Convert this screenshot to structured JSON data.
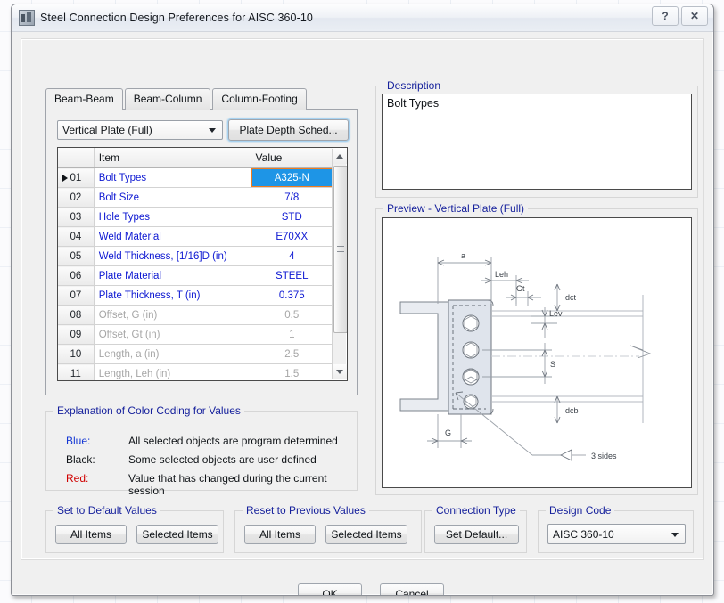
{
  "window": {
    "title": "Steel Connection Design Preferences for AISC 360-10",
    "icon": "app-building-icon",
    "help_btn": "?",
    "close_btn": "✕"
  },
  "tabs": [
    {
      "label": "Beam-Beam",
      "active": true
    },
    {
      "label": "Beam-Column",
      "active": false
    },
    {
      "label": "Column-Footing",
      "active": false
    }
  ],
  "toolbar": {
    "connection_type_value": "Vertical Plate (Full)",
    "plate_depth_label": "Plate Depth Sched..."
  },
  "grid": {
    "headers": {
      "rownum": "",
      "item": "Item",
      "value": "Value"
    },
    "selected_row": 1,
    "rows": [
      {
        "num": "01",
        "item": "Bolt Types",
        "value": "A325-N",
        "style": "blue",
        "selected": true
      },
      {
        "num": "02",
        "item": "Bolt Size",
        "value": "7/8",
        "style": "blue",
        "selected": false
      },
      {
        "num": "03",
        "item": "Hole Types",
        "value": "STD",
        "style": "blue",
        "selected": false
      },
      {
        "num": "04",
        "item": "Weld Material",
        "value": "E70XX",
        "style": "blue",
        "selected": false
      },
      {
        "num": "05",
        "item": "Weld Thickness, [1/16]D (in)",
        "value": "4",
        "style": "blue",
        "selected": false
      },
      {
        "num": "06",
        "item": "Plate Material",
        "value": "STEEL",
        "style": "blue",
        "selected": false
      },
      {
        "num": "07",
        "item": "Plate Thickness, T (in)",
        "value": "0.375",
        "style": "blue",
        "selected": false
      },
      {
        "num": "08",
        "item": "Offset, G (in)",
        "value": "0.5",
        "style": "grey",
        "selected": false
      },
      {
        "num": "09",
        "item": "Offset, Gt (in)",
        "value": "1",
        "style": "grey",
        "selected": false
      },
      {
        "num": "10",
        "item": "Length, a (in)",
        "value": "2.5",
        "style": "grey",
        "selected": false
      },
      {
        "num": "11",
        "item": "Length, Leh (in)",
        "value": "1.5",
        "style": "grey",
        "selected": false
      }
    ]
  },
  "color_coding": {
    "legend": "Explanation of Color Coding for Values",
    "entries": [
      {
        "key": "Blue:",
        "desc": "All selected objects are program determined"
      },
      {
        "key": "Black:",
        "desc": "Some selected objects are user defined"
      },
      {
        "key": "Red:",
        "desc": "Value that has changed during the current session"
      }
    ]
  },
  "description": {
    "legend": "Description",
    "text": "Bolt Types"
  },
  "preview": {
    "legend": "Preview - Vertical Plate (Full)",
    "annotations": [
      "a",
      "Leh",
      "Gt",
      "dct",
      "Lev",
      "S",
      "dcb",
      "G",
      "3 sides"
    ]
  },
  "set_to_default": {
    "legend": "Set to Default Values",
    "all_items": "All Items",
    "selected_items": "Selected Items"
  },
  "reset_to_previous": {
    "legend": "Reset to Previous Values",
    "all_items": "All Items",
    "selected_items": "Selected Items"
  },
  "connection_type": {
    "legend": "Connection Type",
    "set_default": "Set Default..."
  },
  "design_code": {
    "legend": "Design Code",
    "value": "AISC 360-10"
  },
  "footer": {
    "ok": "OK",
    "cancel": "Cancel"
  },
  "colors": {
    "selection_blue": "#1e95e6",
    "value_blue": "#0d18d2",
    "legend_blue": "#16219c",
    "red": "#d00000",
    "disabled_grey": "#a6a6a6"
  }
}
